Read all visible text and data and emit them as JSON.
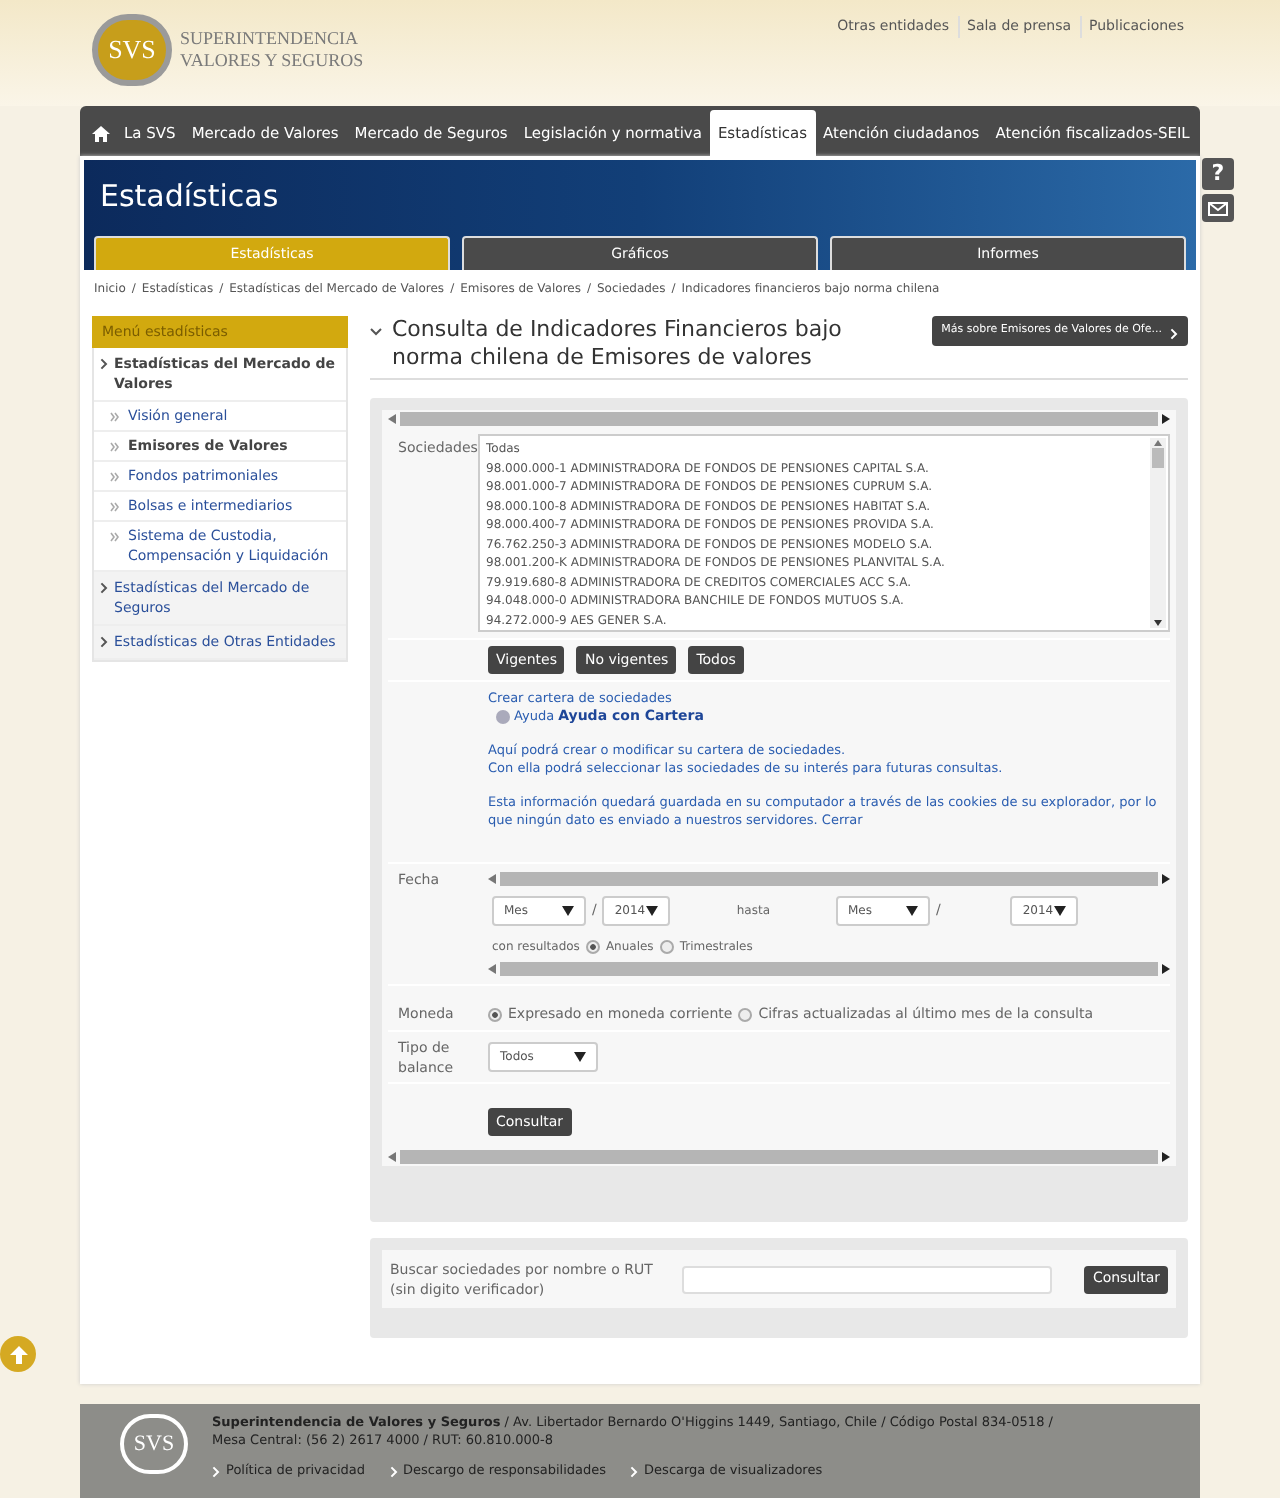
{
  "header": {
    "logo_mark": "SVS",
    "logo_lines": [
      "SUPERINTENDENCIA",
      "VALORES Y SEGUROS"
    ],
    "top_links": [
      "Otras entidades",
      "Sala de prensa",
      "Publicaciones"
    ]
  },
  "nav": [
    {
      "label": "La SVS",
      "selected": false
    },
    {
      "label": "Mercado de Valores",
      "selected": false
    },
    {
      "label": "Mercado de Seguros",
      "selected": false
    },
    {
      "label": "Legislación y normativa",
      "selected": false
    },
    {
      "label": "Estadísticas",
      "selected": true
    },
    {
      "label": "Atención ciudadanos",
      "selected": false
    },
    {
      "label": "Atención fiscalizados-SEIL",
      "selected": false
    }
  ],
  "side_tools": [
    "?"
  ],
  "banner": {
    "title": "Estadísticas",
    "tabs": [
      {
        "label": "Estadísticas",
        "selected": true
      },
      {
        "label": "Gráficos",
        "selected": false
      },
      {
        "label": "Informes",
        "selected": false
      }
    ]
  },
  "breadcrumb_separator": "/",
  "breadcrumb": [
    "Inicio",
    "Estadísticas",
    "Estadísticas del Mercado de Valores",
    "Emisores de Valores",
    "Sociedades",
    "Indicadores financieros bajo norma chilena"
  ],
  "sidebar": {
    "title": "Menú estadísticas",
    "items": [
      {
        "label": "Estadísticas del Mercado de Valores",
        "selected": true,
        "children": [
          {
            "label": "Visión general",
            "selected": false
          },
          {
            "label": "Emisores de Valores",
            "selected": true
          },
          {
            "label": "Fondos patrimoniales",
            "selected": false
          },
          {
            "label": "Bolsas e intermediarios",
            "selected": false
          },
          {
            "label": "Sistema de Custodia, Compensación y Liquidación",
            "selected": false
          }
        ]
      },
      {
        "label": "Estadísticas del Mercado de Seguros",
        "selected": false
      },
      {
        "label": "Estadísticas de Otras Entidades",
        "selected": false
      }
    ]
  },
  "main": {
    "title": "Consulta de Indicadores Financieros bajo norma chilena de Emisores de valores",
    "more_button": "Más sobre Emisores de Valores de Ofe...",
    "sociedades": {
      "label": "Sociedades",
      "options": [
        "Todas",
        "98.000.000-1 ADMINISTRADORA DE FONDOS DE PENSIONES CAPITAL S.A.",
        "98.001.000-7 ADMINISTRADORA DE FONDOS DE PENSIONES CUPRUM S.A.",
        "98.000.100-8 ADMINISTRADORA DE FONDOS DE PENSIONES HABITAT S.A.",
        "98.000.400-7 ADMINISTRADORA DE FONDOS DE PENSIONES PROVIDA S.A.",
        "76.762.250-3 ADMINISTRADORA DE FONDOS DE PENSIONES MODELO S.A.",
        "98.001.200-K ADMINISTRADORA DE FONDOS DE PENSIONES PLANVITAL S.A.",
        "79.919.680-8 ADMINISTRADORA DE CREDITOS COMERCIALES ACC S.A.",
        "94.048.000-0 ADMINISTRADORA BANCHILE DE FONDOS MUTUOS S.A.",
        "94.272.000-9 AES GENER S.A."
      ],
      "filters": [
        "Vigentes",
        "No vigentes",
        "Todos"
      ]
    },
    "cartera": {
      "link": "Crear cartera de sociedades",
      "help": "Ayuda",
      "help_title": "Ayuda con Cartera",
      "lines": [
        "Aquí podrá crear o modificar su cartera de sociedades.",
        "Con ella podrá seleccionar las sociedades de su interés para futuras consultas."
      ],
      "note": "Esta información quedará guardada en su computador a través de las cookies de su explorador, por lo que ningún dato es enviado a nuestros servidores.",
      "close": "Cerrar"
    },
    "fecha": {
      "label": "Fecha",
      "from_month": "Mes",
      "from_year": "2014",
      "date_separator": "/",
      "to_label": "hasta",
      "to_month": "Mes",
      "to_year": "2014",
      "results_label": "con resultados",
      "results": [
        {
          "label": "Anuales",
          "selected": true
        },
        {
          "label": "Trimestrales",
          "selected": false
        }
      ]
    },
    "moneda": {
      "label": "Moneda",
      "options": [
        {
          "label": "Expresado en moneda corriente",
          "selected": true
        },
        {
          "label": "Cifras actualizadas al último mes de la consulta",
          "selected": false
        }
      ]
    },
    "balance": {
      "label": "Tipo de balance",
      "value": "Todos"
    },
    "submit": "Consultar",
    "search": {
      "label": "Buscar sociedades por nombre o RUT (sin digito verificador)",
      "button": "Consultar"
    }
  },
  "footer": {
    "logo_mark": "SVS",
    "org": "Superintendencia de Valores y Seguros",
    "address": " / Av. Libertador Bernardo O'Higgins 1449, Santiago, Chile / Código Postal 834-0518 /",
    "contact": "Mesa Central: (56 2) 2617 4000 / RUT: 60.810.000-8",
    "links": [
      "Política de privacidad",
      "Descargo de responsabilidades",
      "Descarga de visualizadores"
    ]
  }
}
